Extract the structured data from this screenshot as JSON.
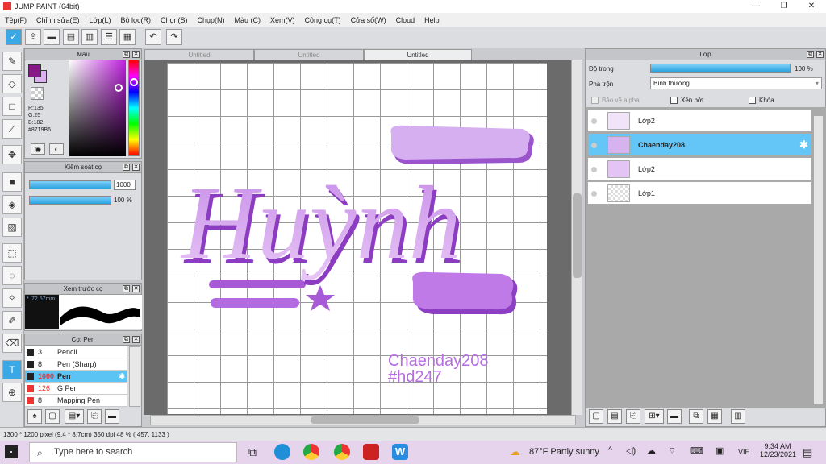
{
  "window": {
    "title": "JUMP PAINT (64bit)",
    "min": "—",
    "max": "❐",
    "close": "✕"
  },
  "menu": [
    "Tệp(F)",
    "Chỉnh sửa(E)",
    "Lớp(L)",
    "Bộ lọc(R)",
    "Chọn(S)",
    "Chụp(N)",
    "Màu (C)",
    "Xem(V)",
    "Công cụ(T)",
    "Cửa sổ(W)",
    "Cloud",
    "Help"
  ],
  "color_panel": {
    "title": "Màu",
    "r": "R:135",
    "g": "G:25",
    "b": "B:182",
    "hex": "#8719B6",
    "fg_color": "#871986",
    "bg_color": "#d9b2ef"
  },
  "brush_control": {
    "title": "Kiểm soát cọ",
    "size": "1000",
    "opacity": "100 %",
    "opacity_fraction": 1.0
  },
  "preview": {
    "title": "Xem trước cọ",
    "size_label": "72.57mm"
  },
  "brush_list": {
    "title": "Cọ: Pen",
    "items": [
      {
        "size": "3",
        "name": "Pencil",
        "color": "#222"
      },
      {
        "size": "8",
        "name": "Pen (Sharp)",
        "color": "#222"
      },
      {
        "size": "1000",
        "name": "Pen",
        "color": "#222",
        "selected": true
      },
      {
        "size": "126",
        "name": "G Pen",
        "color": "#e33"
      },
      {
        "size": "8",
        "name": "Mapping Pen",
        "color": "#e33"
      }
    ]
  },
  "tabs": [
    "Untitled",
    "Untitled",
    "Untitled"
  ],
  "artwork": {
    "main_text": "Huỳnh",
    "caption1": "Chaenday208",
    "caption2": "#hd247",
    "accent": "#b56ee0",
    "light": "#d7aef0"
  },
  "layers_panel": {
    "title": "Lớp",
    "opacity_label": "Độ trong",
    "opacity_value": "100 %",
    "blend_label": "Pha trộn",
    "blend_value": "Bình thường",
    "protect_alpha": "Bảo vệ alpha",
    "clip": "Xén bớt",
    "lock": "Khóa",
    "layers": [
      {
        "name": "Lớp2",
        "selected": false
      },
      {
        "name": "Chaenday208",
        "selected": true
      },
      {
        "name": "Lớp2",
        "selected": false
      },
      {
        "name": "Lớp1",
        "selected": false
      }
    ]
  },
  "status": {
    "text": "1300 * 1200 pixel  (9.4 * 8.7cm)  350 dpi  48 %  ( 457, 1133 )"
  },
  "taskbar": {
    "search_placeholder": "Type here to search",
    "weather": "87°F  Partly sunny",
    "lang": "VIE",
    "time": "9:34 AM",
    "date": "12/23/2021"
  }
}
